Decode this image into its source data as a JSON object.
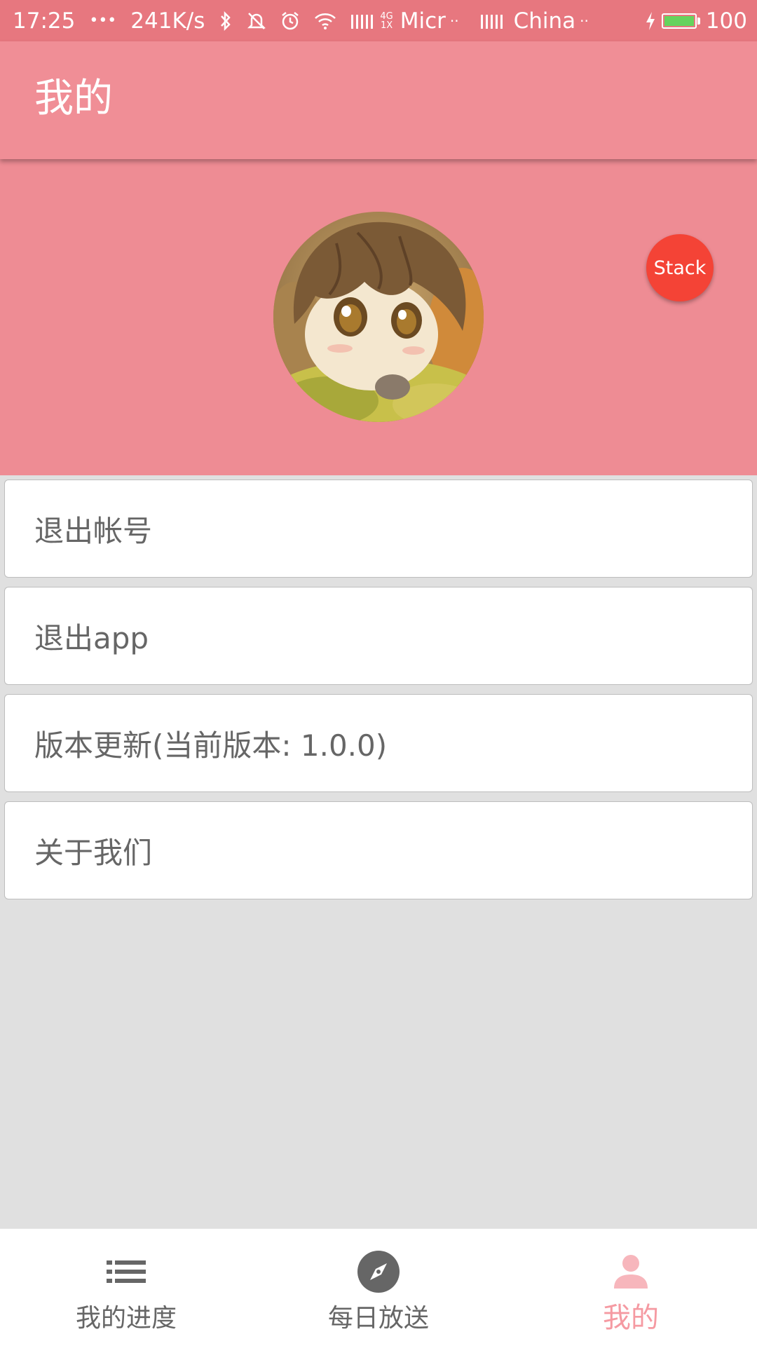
{
  "status_bar": {
    "time": "17:25",
    "dots": "•••",
    "speed": "241K/s",
    "network_4g": "4G",
    "network_1x": "1X",
    "carrier1": "Micr",
    "carrier1_dots": "··",
    "carrier2": "China",
    "carrier2_dots": "··",
    "battery": "100",
    "battery_level_pct": 100,
    "battery_color": "#66d35d"
  },
  "app_bar": {
    "title": "我的",
    "color": "#f08e96"
  },
  "profile": {
    "fab_label": "Stack",
    "fab_color": "#f44336",
    "avatar_icon": "anime-avatar"
  },
  "menu": [
    {
      "label": "退出帐号"
    },
    {
      "label": "退出app"
    },
    {
      "label": "版本更新(当前版本: 1.0.0)"
    },
    {
      "label": "关于我们"
    }
  ],
  "bottom_nav": {
    "items": [
      {
        "label": "我的进度",
        "icon": "list-icon",
        "active": false
      },
      {
        "label": "每日放送",
        "icon": "compass-icon",
        "active": false
      },
      {
        "label": "我的",
        "icon": "person-icon",
        "active": true
      }
    ],
    "active_color": "#f59aa2",
    "inactive_color": "#666666"
  }
}
